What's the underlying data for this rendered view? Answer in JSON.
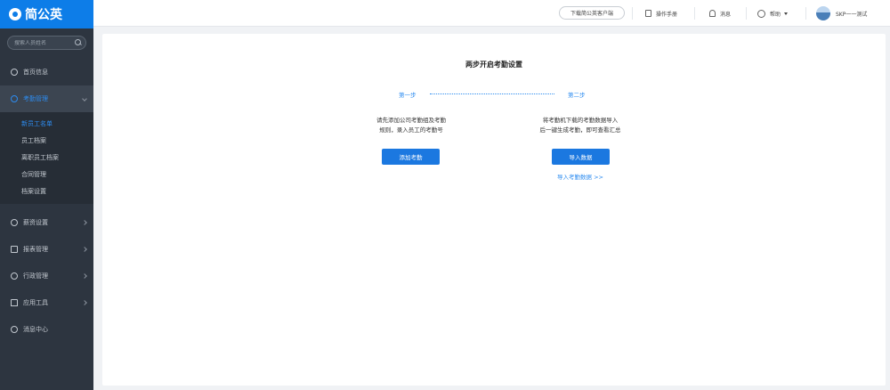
{
  "brand": {
    "name": "简公英"
  },
  "sidebar": {
    "search_placeholder": "搜索人员姓名",
    "items": [
      {
        "label": "首页信息"
      },
      {
        "label": "考勤管理"
      },
      {
        "label": "薪资设置"
      },
      {
        "label": "报表管理"
      },
      {
        "label": "行政管理"
      },
      {
        "label": "应用工具"
      },
      {
        "label": "消息中心"
      }
    ],
    "sub_items": [
      {
        "label": "新员工名单"
      },
      {
        "label": "员工档案"
      },
      {
        "label": "离职员工档案"
      },
      {
        "label": "合同管理"
      },
      {
        "label": "档案设置"
      }
    ]
  },
  "header": {
    "download_label": "下载简公英客户端",
    "link1": "操作手册",
    "link2": "消息",
    "link3": "帮助",
    "user_name": "SKP一一测试"
  },
  "main": {
    "title": "两步开启考勤设置",
    "step1_label": "第一步",
    "step2_label": "第二步",
    "step1_desc": [
      "请先添加公司考勤组及考勤",
      "规则，录入员工的考勤号"
    ],
    "step2_desc": [
      "将考勤机下载的考勤数据导入",
      "后一键生成考勤，即可查看汇总"
    ],
    "step1_button": "添加考勤",
    "step2_button": "导入数据",
    "step2_link": "导入考勤数据 >>"
  },
  "colors": {
    "accent": "#0d7de8",
    "sidebar_bg": "#2d3540",
    "link": "#2d8cf0"
  }
}
